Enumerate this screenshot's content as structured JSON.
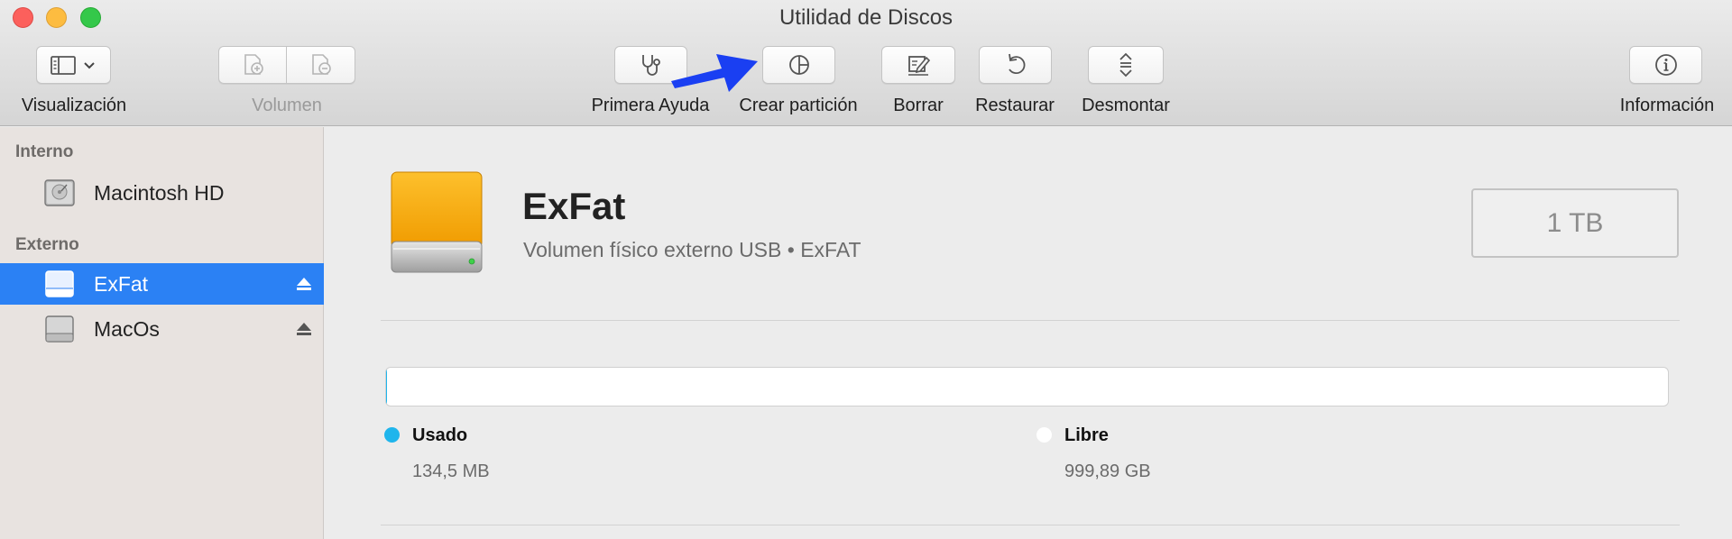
{
  "window": {
    "title": "Utilidad de Discos"
  },
  "toolbar": {
    "view_label": "Visualización",
    "volume_label": "Volumen",
    "first_aid_label": "Primera Ayuda",
    "partition_label": "Crear partición",
    "erase_label": "Borrar",
    "restore_label": "Restaurar",
    "unmount_label": "Desmontar",
    "info_label": "Información"
  },
  "sidebar": {
    "sections": [
      {
        "header": "Interno",
        "items": [
          {
            "label": "Macintosh HD",
            "selected": false,
            "ejectable": false
          }
        ]
      },
      {
        "header": "Externo",
        "items": [
          {
            "label": "ExFat",
            "selected": true,
            "ejectable": true
          },
          {
            "label": "MacOs",
            "selected": false,
            "ejectable": true
          }
        ]
      }
    ]
  },
  "volume": {
    "name": "ExFat",
    "description": "Volumen físico externo USB • ExFAT",
    "capacity": "1 TB",
    "used_fraction": 0.000135,
    "used": {
      "label": "Usado",
      "value": "134,5 MB",
      "color": "#1fb5ec"
    },
    "free": {
      "label": "Libre",
      "value": "999,89 GB",
      "color": "#ffffff"
    }
  },
  "colors": {
    "selection": "#2b81f4",
    "annotation_arrow": "#1a3ff2"
  },
  "icons": {
    "view": "sidebar-toggle-icon",
    "first_aid": "stethoscope-icon",
    "partition": "pie-chart-icon",
    "erase": "eraser-pencil-icon",
    "restore": "restore-arrow-icon",
    "unmount": "unmount-arrows-icon",
    "info": "info-icon"
  }
}
